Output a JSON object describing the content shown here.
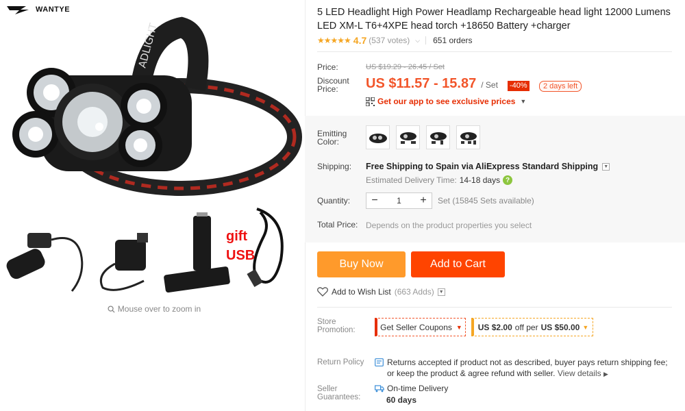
{
  "brand": {
    "name": "WANTYE"
  },
  "image": {
    "headlamp_text": "ADLIGHT",
    "gift_text_1": "gift",
    "gift_text_2": "USB",
    "zoom_hint": "Mouse over to zoom in"
  },
  "product": {
    "title": "5 LED Headlight High Power Headlamp Rechargeable head light 12000 Lumens LED XM-L T6+4XPE head torch +18650 Battery +charger",
    "stars": "★★★★★",
    "rating": "4.7",
    "votes": "(537 votes)",
    "orders": "651 orders"
  },
  "price": {
    "price_label": "Price:",
    "original": "US $19.29 - 26.45 / Set",
    "discount_label": "Discount Price:",
    "current": "US $11.57 - 15.87",
    "unit": "/ Set",
    "discount_badge": "-40%",
    "time_left": "2 days left",
    "app_promo": "Get our app to see exclusive prices"
  },
  "options": {
    "emitting_label": "Emitting Color:",
    "swatch_count_note": "4"
  },
  "shipping": {
    "label": "Shipping:",
    "method": "Free Shipping to Spain via AliExpress Standard Shipping",
    "estimate_label": "Estimated Delivery Time:",
    "estimate_days": "14-18 days"
  },
  "quantity": {
    "label": "Quantity:",
    "value": "1",
    "available": "Set (15845 Sets available)"
  },
  "total": {
    "label": "Total Price:",
    "value": "Depends on the product properties you select"
  },
  "actions": {
    "buy_now": "Buy Now",
    "add_to_cart": "Add to Cart",
    "wishlist": "Add to Wish List",
    "wishlist_count": "(663 Adds)"
  },
  "promotion": {
    "label": "Store Promotion:",
    "coupon_button": "Get Seller Coupons",
    "deal_amount": "US $2.00",
    "deal_mid": "off per",
    "deal_threshold": "US $50.00"
  },
  "return_policy": {
    "label": "Return Policy",
    "text": "Returns accepted if product not as described, buyer pays return shipping fee; or keep the product & agree refund with seller.",
    "link": "View details"
  },
  "guarantee": {
    "label": "Seller Guarantees:",
    "item": "On-time Delivery",
    "days": "60 days"
  },
  "colors": {
    "price_orange": "#f2562b",
    "buy_now": "#ff9a2b",
    "add_to_cart": "#ff4400",
    "star": "#f5a623"
  }
}
